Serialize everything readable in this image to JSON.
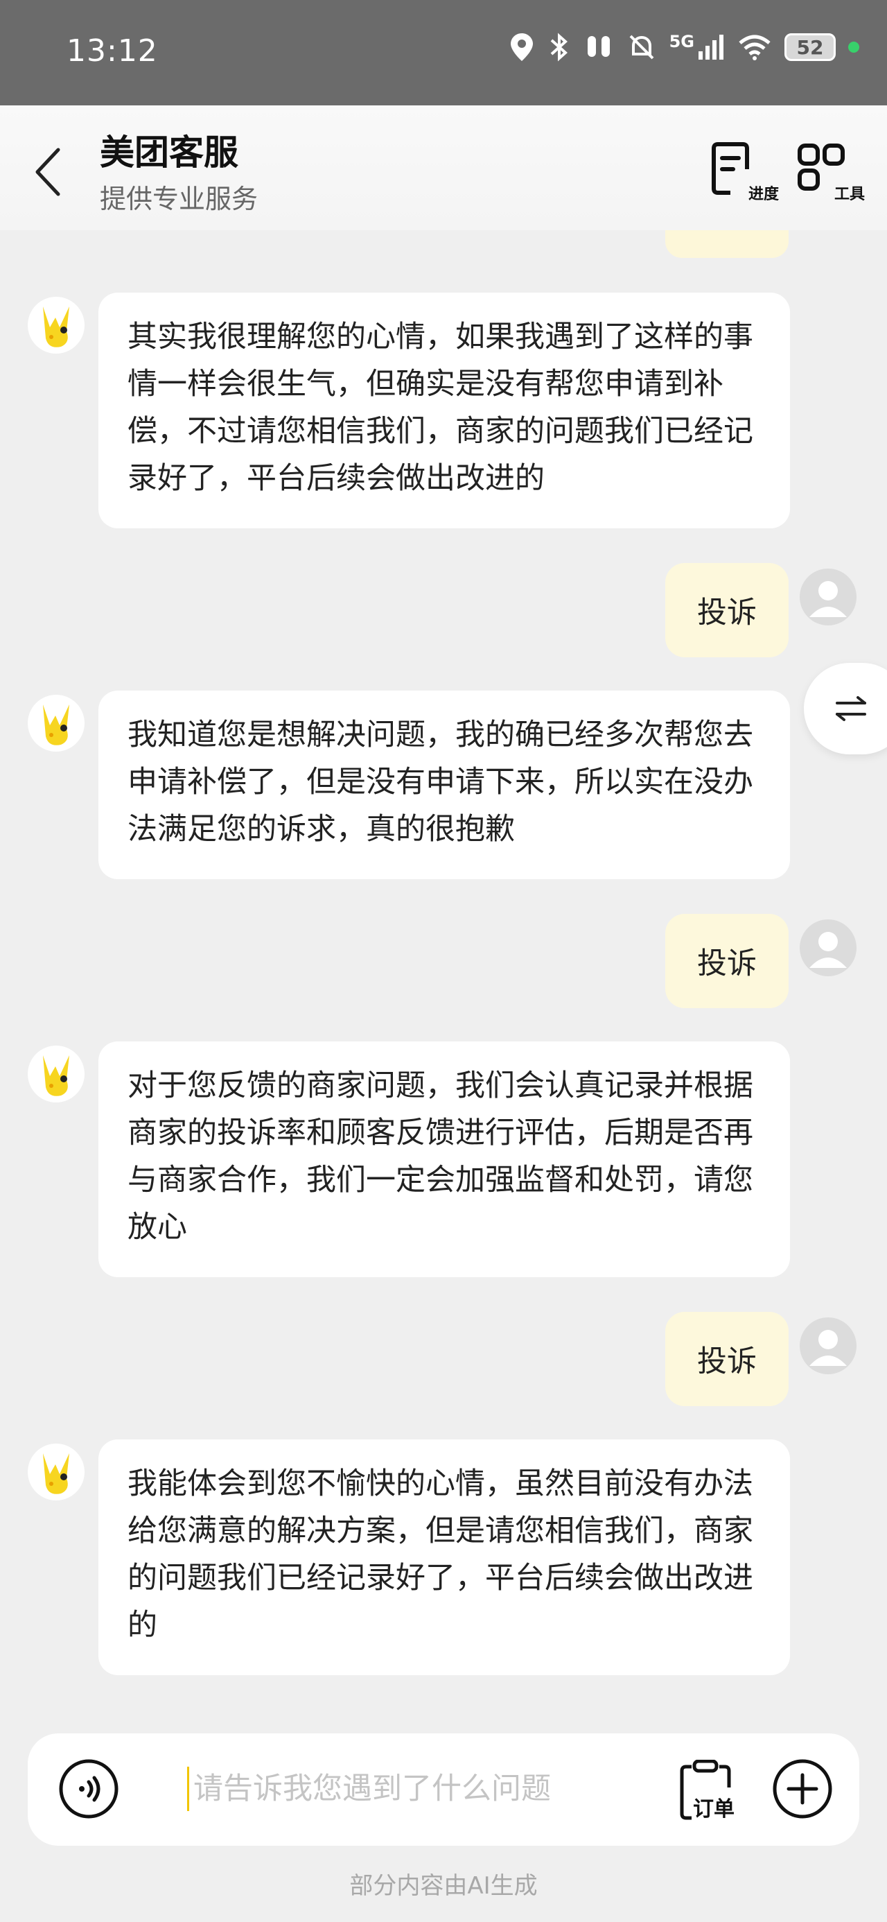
{
  "status_bar": {
    "time": "13:12",
    "network": "5G",
    "battery": "52"
  },
  "header": {
    "title": "美团客服",
    "subtitle": "提供专业服务",
    "progress_label": "进度",
    "tools_label": "工具"
  },
  "messages": [
    {
      "sender": "agent",
      "text": "其实我很理解您的心情，如果我遇到了这样的事情一样会很生气，但确实是没有帮您申请到补偿，不过请您相信我们，商家的问题我们已经记录好了，平台后续会做出改进的"
    },
    {
      "sender": "user",
      "text": "投诉"
    },
    {
      "sender": "agent",
      "text": "我知道您是想解决问题，我的确已经多次帮您去申请补偿了，但是没有申请下来，所以实在没办法满足您的诉求，真的很抱歉"
    },
    {
      "sender": "user",
      "text": "投诉"
    },
    {
      "sender": "agent",
      "text": "对于您反馈的商家问题，我们会认真记录并根据商家的投诉率和顾客反馈进行评估，后期是否再与商家合作，我们一定会加强监督和处罚，请您放心"
    },
    {
      "sender": "user",
      "text": "投诉"
    },
    {
      "sender": "agent",
      "text": "我能体会到您不愉快的心情，虽然目前没有办法给您满意的解决方案，但是请您相信我们，商家的问题我们已经记录好了，平台后续会做出改进的"
    }
  ],
  "input": {
    "placeholder": "请告诉我您遇到了什么问题",
    "value": "",
    "order_label": "订单"
  },
  "footer_note": "部分内容由AI生成",
  "colors": {
    "accent": "#f2c500",
    "user_bubble": "#fdf8dc",
    "agent_bubble": "#ffffff",
    "status_bar": "#6b6b6b"
  }
}
